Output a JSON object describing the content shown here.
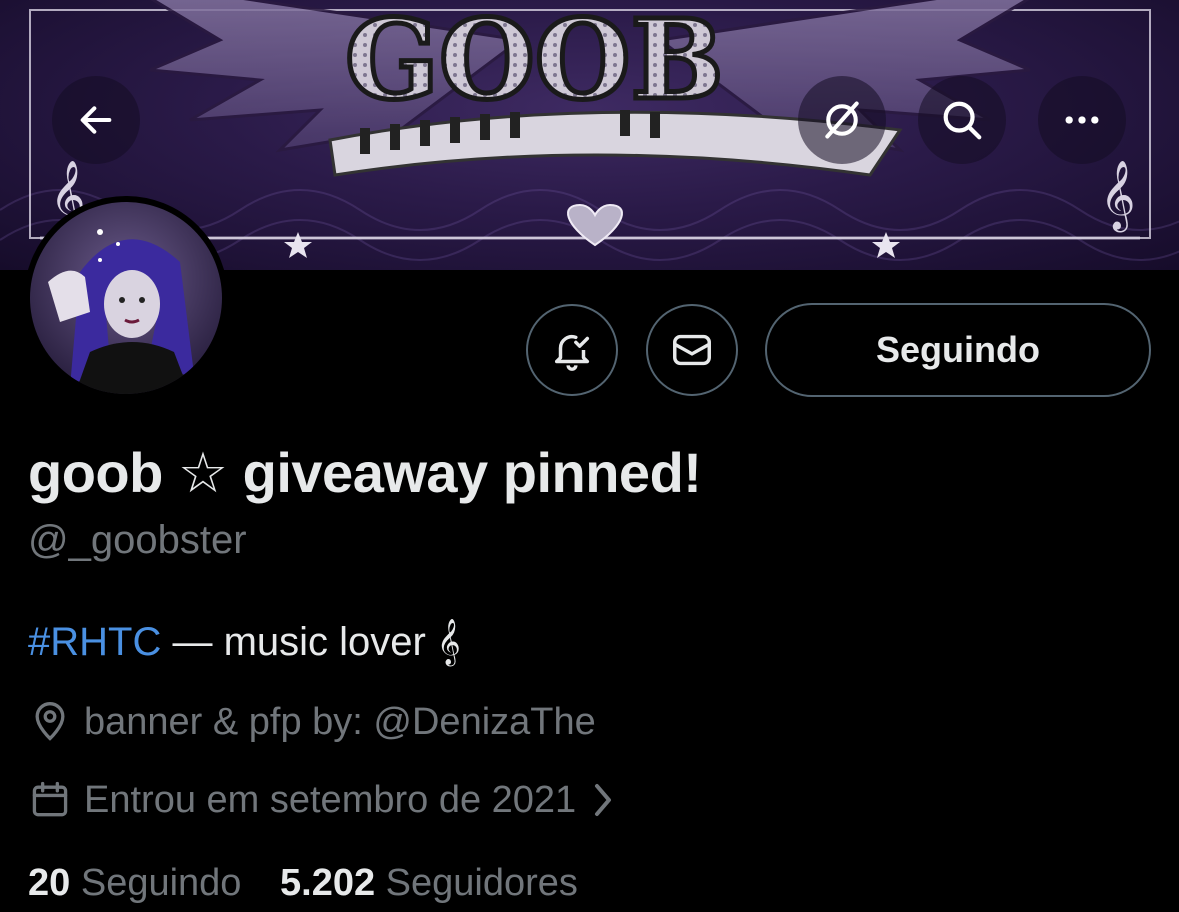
{
  "banner": {
    "logo_text": "GOOB"
  },
  "nav": {
    "back_icon": "arrow-left-icon",
    "grok_icon": "slashed-circle-icon",
    "search_icon": "search-icon",
    "more_icon": "more-horizontal-icon"
  },
  "actions": {
    "notifications_icon": "bell-check-icon",
    "message_icon": "envelope-icon",
    "follow_label": "Seguindo"
  },
  "profile": {
    "display_name": "goob ☆ giveaway pinned!",
    "handle": "@_goobster",
    "bio_hashtag": "#RHTC",
    "bio_text": " — music lover 𝄞",
    "location": "banner & pfp by: @DenizaThe",
    "joined": "Entrou em setembro de 2021"
  },
  "stats": {
    "following_count": "20",
    "following_label": "Seguindo",
    "followers_count": "5.202",
    "followers_label": "Seguidores"
  },
  "colors": {
    "background": "#000000",
    "text": "#e7e9ea",
    "muted": "#71767b",
    "hashtag": "#4a90e2",
    "border": "#536471"
  }
}
